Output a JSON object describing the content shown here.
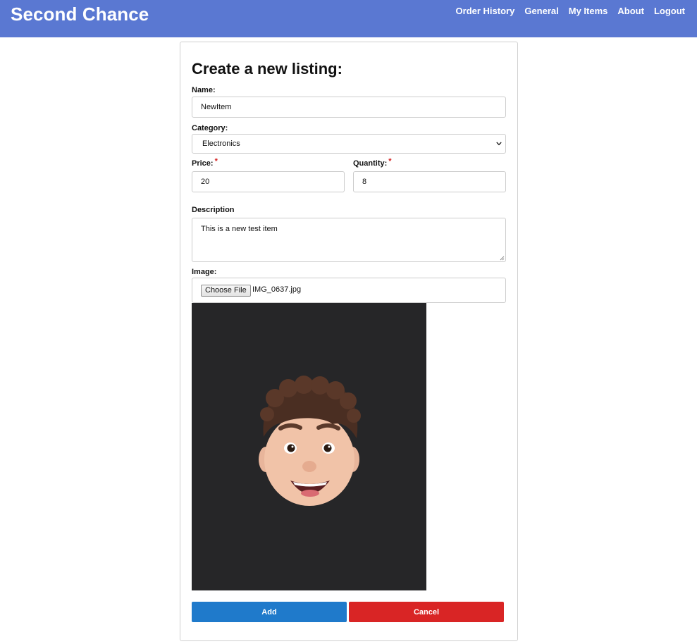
{
  "header": {
    "brand": "Second Chance",
    "nav": [
      {
        "label": "Order History"
      },
      {
        "label": "General"
      },
      {
        "label": "My Items"
      },
      {
        "label": "About"
      },
      {
        "label": "Logout"
      }
    ]
  },
  "form": {
    "title": "Create a new listing:",
    "name": {
      "label": "Name:",
      "value": "NewItem"
    },
    "category": {
      "label": "Category:",
      "selected": "Electronics"
    },
    "price": {
      "label": "Price:",
      "required_mark": "*",
      "value": "20"
    },
    "quantity": {
      "label": "Quantity:",
      "required_mark": "*",
      "value": "8"
    },
    "description": {
      "label": "Description",
      "value": "This is a new test item"
    },
    "image": {
      "label": "Image:",
      "choose_label": "Choose File",
      "file_name": "IMG_0637.jpg"
    },
    "add_label": "Add",
    "cancel_label": "Cancel"
  },
  "colors": {
    "header_bg": "#5a78d2",
    "add_button": "#1f7acb",
    "cancel_button": "#d92525",
    "required": "#d32020"
  }
}
